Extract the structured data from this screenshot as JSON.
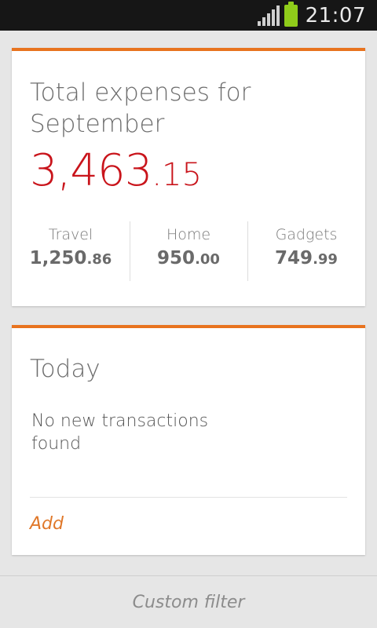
{
  "status_bar": {
    "time": "21:07"
  },
  "summary": {
    "title": "Total expenses for September",
    "total_integer": "3,463",
    "total_decimal": ".15",
    "categories": [
      {
        "name": "Travel",
        "integer": "1,250",
        "decimal": ".86"
      },
      {
        "name": "Home",
        "integer": "950",
        "decimal": ".00"
      },
      {
        "name": "Gadgets",
        "integer": "749",
        "decimal": ".99"
      }
    ]
  },
  "today": {
    "title": "Today",
    "empty_message": "No new transactions found",
    "add_label": "Add"
  },
  "bottom_bar": {
    "label": "Custom filter"
  },
  "colors": {
    "accent": "#e8731f",
    "total_amount": "#c9141b",
    "battery": "#8fcc1a"
  },
  "icons": [
    "signal-icon",
    "battery-icon"
  ]
}
